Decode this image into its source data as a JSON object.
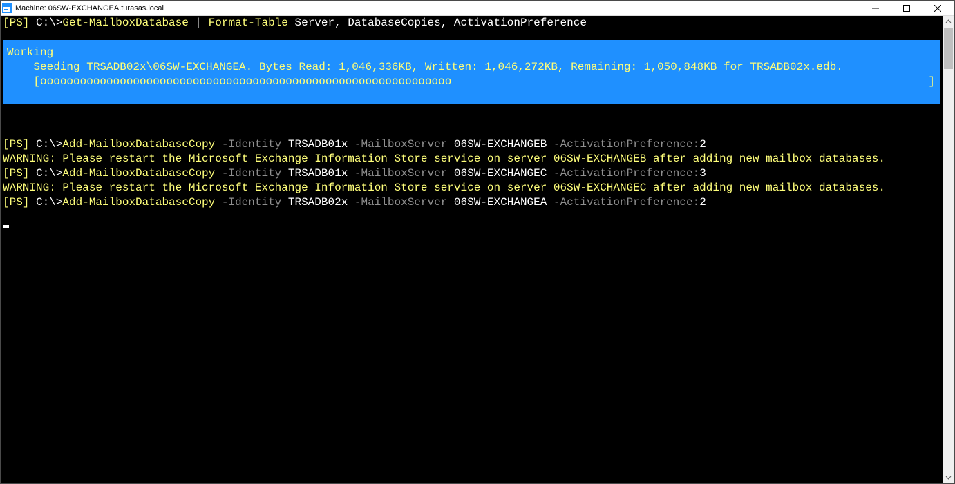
{
  "window": {
    "title": "Machine: 06SW-EXCHANGEA.turasas.local"
  },
  "line1": {
    "ps": "[PS] ",
    "path": "C:\\>",
    "cmd1": "Get-MailboxDatabase ",
    "pipe": "| ",
    "cmd2": "Format-Table ",
    "args": "Server, DatabaseCopies, ActivationPreference"
  },
  "progress": {
    "title": "Working",
    "status": "    Seeding TRSADB02x\\06SW-EXCHANGEA. Bytes Read: 1,046,336KB, Written: 1,046,272KB, Remaining: 1,050,848KB for TRSADB02x.edb.",
    "indent": "    ",
    "bar": "[oooooooooooooooooooooooooooooooooooooooooooooooooooooooooooooo",
    "cap": "]"
  },
  "cmdA": {
    "ps": "[PS] ",
    "path": "C:\\>",
    "cmd": "Add-MailboxDatabaseCopy ",
    "p1": "-Identity ",
    "a1": "TRSADB01x ",
    "p2": "-MailboxServer ",
    "a2": "06SW-EXCHANGEB ",
    "p3": "-ActivationPreference:",
    "a3": "2"
  },
  "warnA": "WARNING: Please restart the Microsoft Exchange Information Store service on server 06SW-EXCHANGEB after adding new mailbox databases.",
  "cmdB": {
    "ps": "[PS] ",
    "path": "C:\\>",
    "cmd": "Add-MailboxDatabaseCopy ",
    "p1": "-Identity ",
    "a1": "TRSADB01x ",
    "p2": "-MailboxServer ",
    "a2": "06SW-EXCHANGEC ",
    "p3": "-ActivationPreference:",
    "a3": "3"
  },
  "warnB": "WARNING: Please restart the Microsoft Exchange Information Store service on server 06SW-EXCHANGEC after adding new mailbox databases.",
  "cmdC": {
    "ps": "[PS] ",
    "path": "C:\\>",
    "cmd": "Add-MailboxDatabaseCopy ",
    "p1": "-Identity ",
    "a1": "TRSADB02x ",
    "p2": "-MailboxServer ",
    "a2": "06SW-EXCHANGEA ",
    "p3": "-ActivationPreference:",
    "a3": "2"
  }
}
